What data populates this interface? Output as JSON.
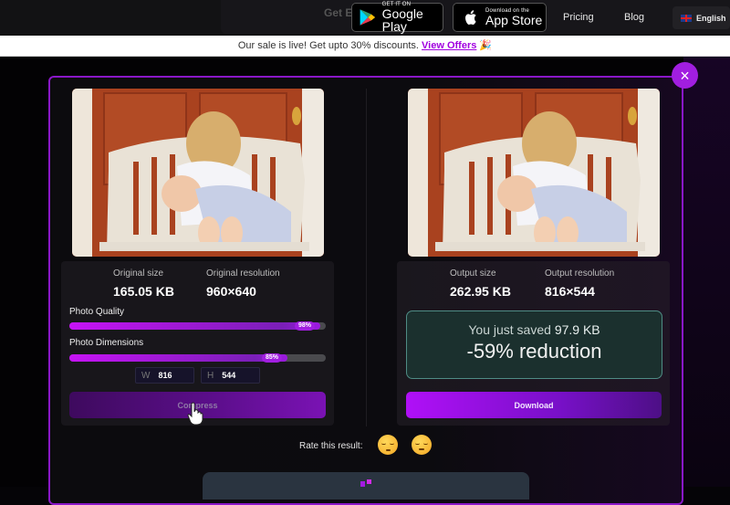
{
  "header": {
    "get_app_partial": "Get E",
    "google_play": {
      "small": "GET IT ON",
      "big": "Google Play"
    },
    "app_store": {
      "small": "Download on the",
      "big": "App Store"
    },
    "nav": [
      "Pricing",
      "Blog"
    ],
    "language": "English"
  },
  "promo": {
    "text": "Our sale is live! Get upto 30% discounts. ",
    "link": "View Offers",
    "emoji": "🎉"
  },
  "modal": {
    "close_icon": "×",
    "original": {
      "size_label": "Original size",
      "size_value": "165.05 KB",
      "resolution_label": "Original resolution",
      "resolution_value": "960×640"
    },
    "quality": {
      "label": "Photo Quality",
      "value_percent": 98,
      "badge": "98%"
    },
    "dimensions": {
      "label": "Photo Dimensions",
      "value_percent": 85,
      "badge": "85%",
      "width_label": "W",
      "width_value": "816",
      "height_label": "H",
      "height_value": "544"
    },
    "compress_label": "Compress",
    "output": {
      "size_label": "Output size",
      "size_value": "262.95 KB",
      "resolution_label": "Output resolution",
      "resolution_value": "816×544"
    },
    "saved": {
      "prefix": "You just saved ",
      "amount": "97.9 KB",
      "reduction": "-59% reduction"
    },
    "download_label": "Download",
    "rate_label": "Rate this result:",
    "ratings": [
      "sad-face",
      "neutral-face"
    ]
  },
  "colors": {
    "accent": "#a11ee0",
    "saved_border": "#4f8c85"
  }
}
